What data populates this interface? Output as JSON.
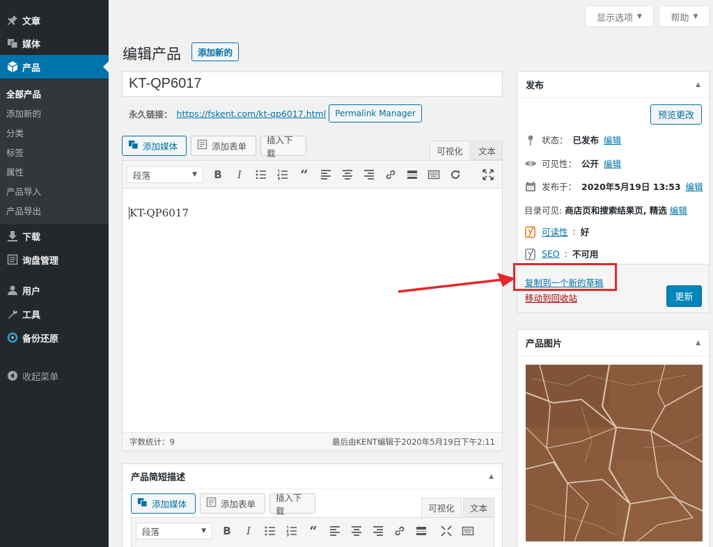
{
  "sidebar": {
    "items": [
      {
        "label": "文章",
        "icon": "pin-icon"
      },
      {
        "label": "媒体",
        "icon": "media-icon"
      },
      {
        "label": "产品",
        "icon": "product-box-icon"
      },
      {
        "label": "下载",
        "icon": "download-icon"
      },
      {
        "label": "询盘管理",
        "icon": "inquiry-icon"
      },
      {
        "label": "用户",
        "icon": "user-icon"
      },
      {
        "label": "工具",
        "icon": "wrench-icon"
      },
      {
        "label": "备份还原",
        "icon": "backup-icon"
      }
    ],
    "submenu": [
      "全部产品",
      "添加新的",
      "分类",
      "标签",
      "属性",
      "产品导入",
      "产品导出"
    ],
    "collapse_label": "收起菜单"
  },
  "screen_meta": {
    "options_label": "显示选项",
    "help_label": "帮助"
  },
  "header": {
    "title": "编辑产品",
    "add_new_label": "添加新的"
  },
  "post": {
    "title": "KT-QP6017",
    "permalink_label": "永久链接：",
    "permalink_url": "https://fskent.com/kt-qp6017.html",
    "permalink_manager_label": "Permalink Manager"
  },
  "editor": {
    "add_media_label": "添加媒体",
    "add_form_label": "添加表单",
    "insert_download_label": "插入下载",
    "tab_visual": "可视化",
    "tab_text": "文本",
    "format_select": "段落",
    "content": "KT-QP6017",
    "word_count": "字数统计：9",
    "last_edited": "最后由KENT编辑于2020年5月19日下午2:11"
  },
  "short_description": {
    "title": "产品简短描述",
    "add_media_label": "添加媒体",
    "add_form_label": "添加表单",
    "insert_download_label": "插入下载",
    "tab_visual": "可视化",
    "tab_text": "文本",
    "format_select": "段落"
  },
  "publish": {
    "title": "发布",
    "preview_label": "预览更改",
    "status_label": "状态：",
    "status_value": "已发布",
    "visibility_label": "可见性：",
    "visibility_value": "公开",
    "published_label": "发布于：",
    "published_value": "2020年5月19日 13:53",
    "catalog_label": "目录可见:",
    "catalog_value": "商店页和搜索结果页, 精选",
    "edit_label": "编辑",
    "readability_label": "可读性",
    "readability_value": "好",
    "seo_label": "SEO",
    "seo_value": "不可用",
    "duplicate_label": "复制到一个新的草稿",
    "trash_label": "移动到回收站",
    "update_label": "更新"
  },
  "product_image": {
    "title": "产品图片"
  },
  "colors": {
    "accent": "#0073aa",
    "sidebar": "#23282d",
    "highlight": "#e8262a",
    "update_button": "#0085ba"
  }
}
